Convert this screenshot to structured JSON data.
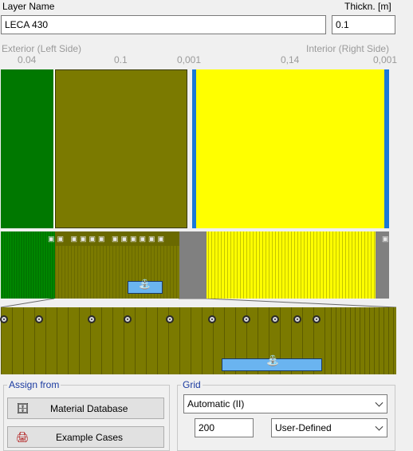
{
  "layer_name_label": "Layer Name",
  "layer_name_value": "LECA 430",
  "thickness_label": "Thickn. [m]",
  "thickness_value": "0.1",
  "exterior_label": "Exterior (Left Side)",
  "interior_label": "Interior (Right Side)",
  "layer_thicknesses": [
    "0.04",
    "0.1",
    "0,001",
    "0,14",
    "0,001"
  ],
  "colors": {
    "green": "#007800",
    "olive": "#7b7a00",
    "yellow": "#ffff00",
    "blue": "#1a78d8",
    "gray": "#808080"
  },
  "assign_from": {
    "legend": "Assign from",
    "material_database_label": "Material Database",
    "example_cases_label": "Example Cases"
  },
  "grid": {
    "legend": "Grid",
    "mode_value": "Automatic (II)",
    "count_value": "200",
    "type_value": "User-Defined"
  }
}
